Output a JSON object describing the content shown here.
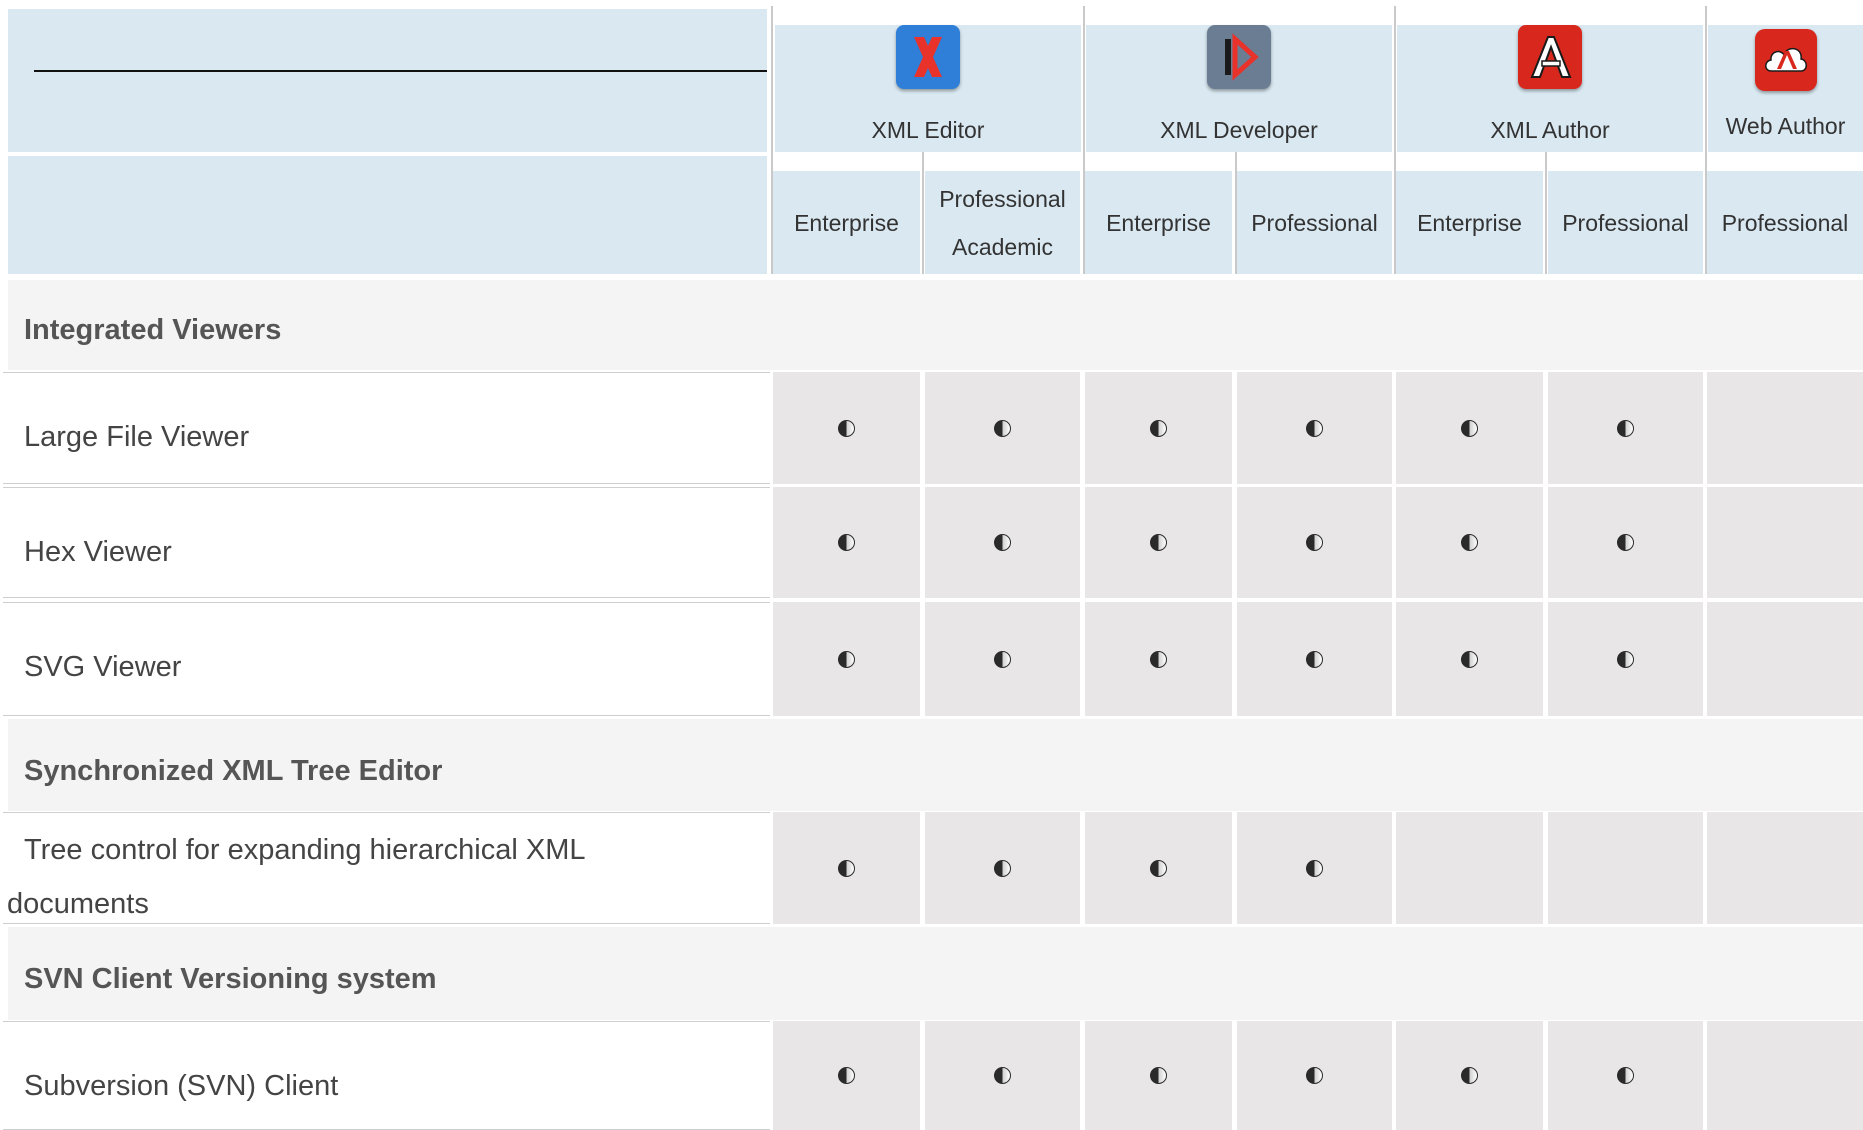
{
  "products": [
    {
      "name": "XML Editor",
      "icon": "xml-editor-logo-icon",
      "color": "#2f7fd8"
    },
    {
      "name": "XML Developer",
      "icon": "xml-developer-logo-icon",
      "color": "#6b7d92"
    },
    {
      "name": "XML Author",
      "icon": "xml-author-logo-icon",
      "color": "#d8281e"
    },
    {
      "name": "Web Author",
      "icon": "web-author-logo-icon",
      "color": "#d8281e"
    }
  ],
  "editions": [
    {
      "line1": "Enterprise"
    },
    {
      "line1": "Professional",
      "line2": "Academic"
    },
    {
      "line1": "Enterprise"
    },
    {
      "line1": "Professional"
    },
    {
      "line1": "Enterprise"
    },
    {
      "line1": "Professional"
    },
    {
      "line1": "Professional"
    }
  ],
  "sections": [
    {
      "title": "Integrated Viewers"
    },
    {
      "title": "Synchronized XML Tree Editor"
    },
    {
      "title": "SVN Client Versioning system"
    }
  ],
  "features": [
    {
      "label": "Large File Viewer",
      "support": [
        true,
        true,
        true,
        true,
        true,
        true,
        false
      ]
    },
    {
      "label": "Hex Viewer",
      "support": [
        true,
        true,
        true,
        true,
        true,
        true,
        false
      ]
    },
    {
      "label": "SVG Viewer",
      "support": [
        true,
        true,
        true,
        true,
        true,
        true,
        false
      ]
    },
    {
      "label_line1": "Tree control for expanding hierarchical XML",
      "label_line2": "documents",
      "support": [
        true,
        true,
        true,
        true,
        false,
        false,
        false
      ]
    },
    {
      "label": "Subversion (SVN) Client",
      "support": [
        true,
        true,
        true,
        true,
        true,
        true,
        false
      ]
    }
  ],
  "colors": {
    "header_bg": "#d9e8f1",
    "section_bg": "#f4f4f4",
    "cell_shaded": "#e8e6e6",
    "cell_light": "#f1f1f1"
  }
}
